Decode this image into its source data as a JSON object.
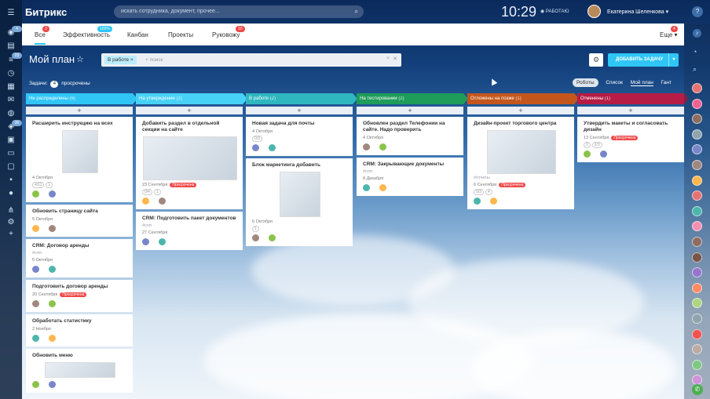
{
  "app": {
    "logo": "Битрикс",
    "search_placeholder": "искать сотрудника, документ, прочее...",
    "clock": "10:29",
    "status": "РАБОТАЮ",
    "user": "Екатерина Шеленкова",
    "help": "?"
  },
  "tabs": [
    {
      "label": "Все",
      "badge": "3"
    },
    {
      "label": "Эффективность",
      "badge": "100%"
    },
    {
      "label": "Канбан",
      "badge": ""
    },
    {
      "label": "Проекты",
      "badge": ""
    },
    {
      "label": "Руковожу",
      "badge": "10"
    },
    {
      "label": "Еще",
      "badge": "4"
    }
  ],
  "plan": {
    "title": "Мой план",
    "filter_tag": "В работе",
    "filter_placeholder": "+ поиск",
    "add_button": "ДОБАВИТЬ ЗАДАЧУ",
    "tasks_label": "Задачи:",
    "tasks_count": "4",
    "tasks_overdue": "просрочены",
    "views": [
      "Роботы",
      "Список",
      "Мой план",
      "Гант"
    ]
  },
  "leftbar": {
    "badges": [
      "4",
      "23",
      "30"
    ]
  },
  "columns": [
    {
      "name": "Не распределены",
      "count": "(6)",
      "color": "#2fc6f6",
      "cards": [
        {
          "title": "Расширить инструкцию на всех",
          "tag": "",
          "date": "4 Октября",
          "overdue": false,
          "meta": [
            "4/11",
            "1"
          ],
          "thumb": [
            46,
            55
          ]
        },
        {
          "title": "Обновить страницу сайта",
          "tag": "",
          "date": "5 Октября",
          "overdue": false,
          "meta": []
        },
        {
          "title": "CRM: Договор аренды",
          "tag": "#crm",
          "date": "5 Октября",
          "overdue": false,
          "meta": []
        },
        {
          "title": "Подготовить договор аренды",
          "tag": "",
          "date": "20 Сентября",
          "overdue": true,
          "meta": []
        },
        {
          "title": "Обработать статистику",
          "tag": "",
          "date": "2 Ноября",
          "overdue": false,
          "meta": []
        },
        {
          "title": "Обновить меню",
          "tag": "",
          "date": "",
          "overdue": false,
          "meta": [],
          "thumb": [
            90,
            20
          ]
        }
      ]
    },
    {
      "name": "На утверждении",
      "count": "(2)",
      "color": "#47d1f7",
      "cards": [
        {
          "title": "Добавить раздел в отдельной секции на сайте",
          "tag": "",
          "date": "23 Сентября",
          "overdue": true,
          "meta": [
            "0/4",
            "1"
          ],
          "thumb": [
            120,
            56
          ]
        },
        {
          "title": "CRM: Подготовить пакет документов",
          "tag": "#crm",
          "date": "27 Сентября",
          "overdue": false,
          "meta": []
        }
      ]
    },
    {
      "name": "В работе",
      "count": "(2)",
      "color": "#2fb7c0",
      "cards": [
        {
          "title": "Новая задача для почты",
          "tag": "",
          "date": "4 Октября",
          "overdue": false,
          "meta": [
            "0/3"
          ]
        },
        {
          "title": "Блок маркетинга добавить",
          "tag": "",
          "date": "6 Октября",
          "overdue": false,
          "meta": [
            "1"
          ],
          "thumb": [
            52,
            58
          ]
        }
      ]
    },
    {
      "name": "На тестировании",
      "count": "(2)",
      "color": "#1e9c5a",
      "cards": [
        {
          "title": "Обновлен раздел Телефонии на сайте. Надо проверить",
          "tag": "",
          "date": "4 Октября",
          "overdue": false,
          "meta": []
        },
        {
          "title": "CRM: Закрывающие документы",
          "tag": "#crm",
          "date": "8 Декабря",
          "overdue": false,
          "meta": []
        }
      ]
    },
    {
      "name": "Отложены на позже",
      "count": "(1)",
      "color": "#c4561c",
      "cards": [
        {
          "title": "Дизайн-проект торгового центра",
          "tag": "#отчеты",
          "date": "6 Сентября",
          "overdue": true,
          "meta": [
            "0/3",
            "4"
          ],
          "thumb": [
            88,
            56
          ]
        }
      ]
    },
    {
      "name": "Отменены",
      "count": "(1)",
      "color": "#b61c45",
      "cards": [
        {
          "title": "Утвердить макеты и согласовать дизайн",
          "tag": "",
          "date": "13 Сентября",
          "overdue": true,
          "meta": [
            "2",
            "2/3"
          ]
        }
      ]
    }
  ],
  "labels": {
    "overdue": "Просрочена"
  },
  "colors": {
    "accent": "#2fc6f6",
    "overdue": "#f04747"
  }
}
